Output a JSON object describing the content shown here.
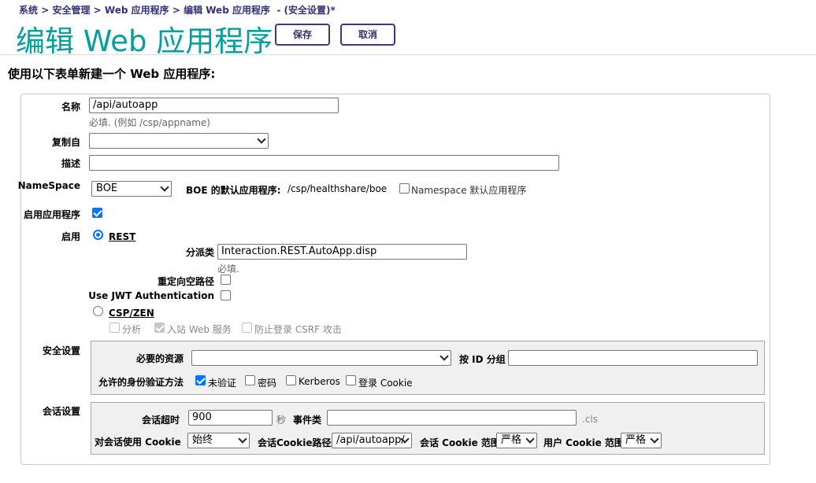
{
  "breadcrumb": {
    "items": [
      "系统",
      "安全管理",
      "Web 应用程序",
      "编辑 Web 应用程序"
    ],
    "separator": ">",
    "suffix": "- (安全设置)*"
  },
  "page_title": "编辑 Web 应用程序",
  "toolbar": {
    "save_label": "保存",
    "cancel_label": "取消"
  },
  "subtitle": "使用以下表单新建一个 Web 应用程序:",
  "form": {
    "name_label": "名称",
    "name_value": "/api/autoapp",
    "name_hint": "必填.  (例如 /csp/appname)",
    "copy_from_label": "复制自",
    "copy_from_value": "",
    "description_label": "描述",
    "description_value": "",
    "namespace_label": "NameSpace",
    "namespace_value": "BOE",
    "default_app_label": "BOE 的默认应用程序:",
    "default_app_value": "/csp/healthshare/boe",
    "ns_default_label": "Namespace 默认应用程序",
    "enable_app_label": "启用应用程序",
    "enable_label": "启用",
    "rest_label": "REST",
    "dispatch_label": "分派类",
    "dispatch_value": "Interaction.REST.AutoApp.disp",
    "dispatch_hint": "必填.",
    "redirect_label": "重定向空路径",
    "jwt_label": "Use JWT Authentication",
    "csp_label": "CSP/ZEN",
    "csp_options": [
      "分析",
      "入站 Web 服务",
      "防止登录 CSRF 攻击"
    ]
  },
  "security": {
    "section_label": "安全设置",
    "resource_label": "必要的资源",
    "resource_value": "",
    "group_label": "按 ID 分组",
    "group_value": "",
    "auth_label": "允许的身份验证方法",
    "auth_methods": [
      "未验证",
      "密码",
      "Kerberos",
      "登录 Cookie"
    ]
  },
  "session": {
    "section_label": "会话设置",
    "timeout_label": "会话超时",
    "timeout_value": "900",
    "timeout_unit": "秒",
    "event_class_label": "事件类",
    "event_class_value": "",
    "event_class_suffix": ".cls",
    "use_cookie_label": "对会话使用 Cookie",
    "use_cookie_value": "始终",
    "cookie_path_label": "会话Cookie路径",
    "cookie_path_value": "/api/autoapp/",
    "cookie_scope_label": "会话 Cookie 范围",
    "cookie_scope_value": "严格",
    "user_cookie_scope_label": "用户 Cookie 范围",
    "user_cookie_scope_value": "严格"
  }
}
